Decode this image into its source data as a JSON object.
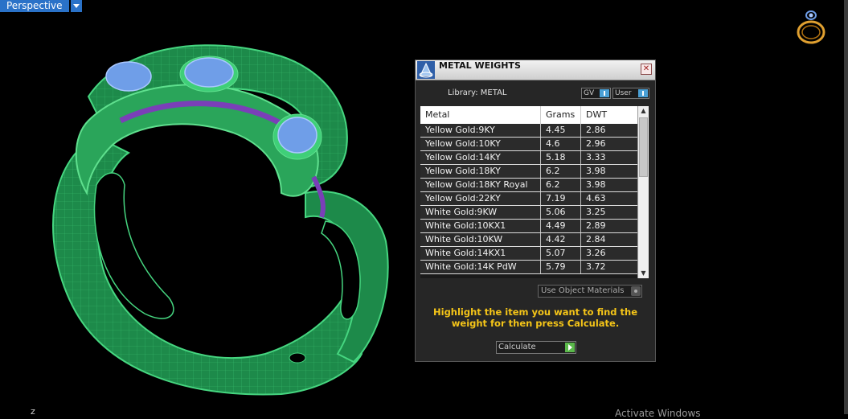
{
  "viewport": {
    "view_name": "Perspective",
    "axis_label": "z",
    "watermark": "Activate Windows"
  },
  "panel": {
    "title": "METAL WEIGHTS",
    "close_label": "✕",
    "library_label": "Library: METAL",
    "toggle_gv": "GV",
    "toggle_user": "User",
    "columns": [
      "Metal",
      "Grams",
      "DWT"
    ],
    "rows": [
      [
        "Yellow Gold:9KY",
        "4.45",
        "2.86"
      ],
      [
        "Yellow Gold:10KY",
        "4.6",
        "2.96"
      ],
      [
        "Yellow Gold:14KY",
        "5.18",
        "3.33"
      ],
      [
        "Yellow Gold:18KY",
        "6.2",
        "3.98"
      ],
      [
        "Yellow Gold:18KY Royal",
        "6.2",
        "3.98"
      ],
      [
        "Yellow Gold:22KY",
        "7.19",
        "4.63"
      ],
      [
        "White Gold:9KW",
        "5.06",
        "3.25"
      ],
      [
        "White Gold:10KX1",
        "4.49",
        "2.89"
      ],
      [
        "White Gold:10KW",
        "4.42",
        "2.84"
      ],
      [
        "White Gold:14KX1",
        "5.07",
        "3.26"
      ],
      [
        "White Gold:14K PdW",
        "5.79",
        "3.72"
      ]
    ],
    "use_object_materials": "Use Object Materials",
    "hint": "Highlight the item you want to find the weight for then press Calculate.",
    "calculate_label": "Calculate"
  },
  "colors": {
    "ring_green": "#1d8a4a",
    "ring_green_light": "#46d680",
    "gem_blue": "#6f9ee8",
    "channel_purple": "#7a3fb8",
    "hint_yellow": "#f5c518",
    "view_tab_blue": "#2a72c8"
  }
}
